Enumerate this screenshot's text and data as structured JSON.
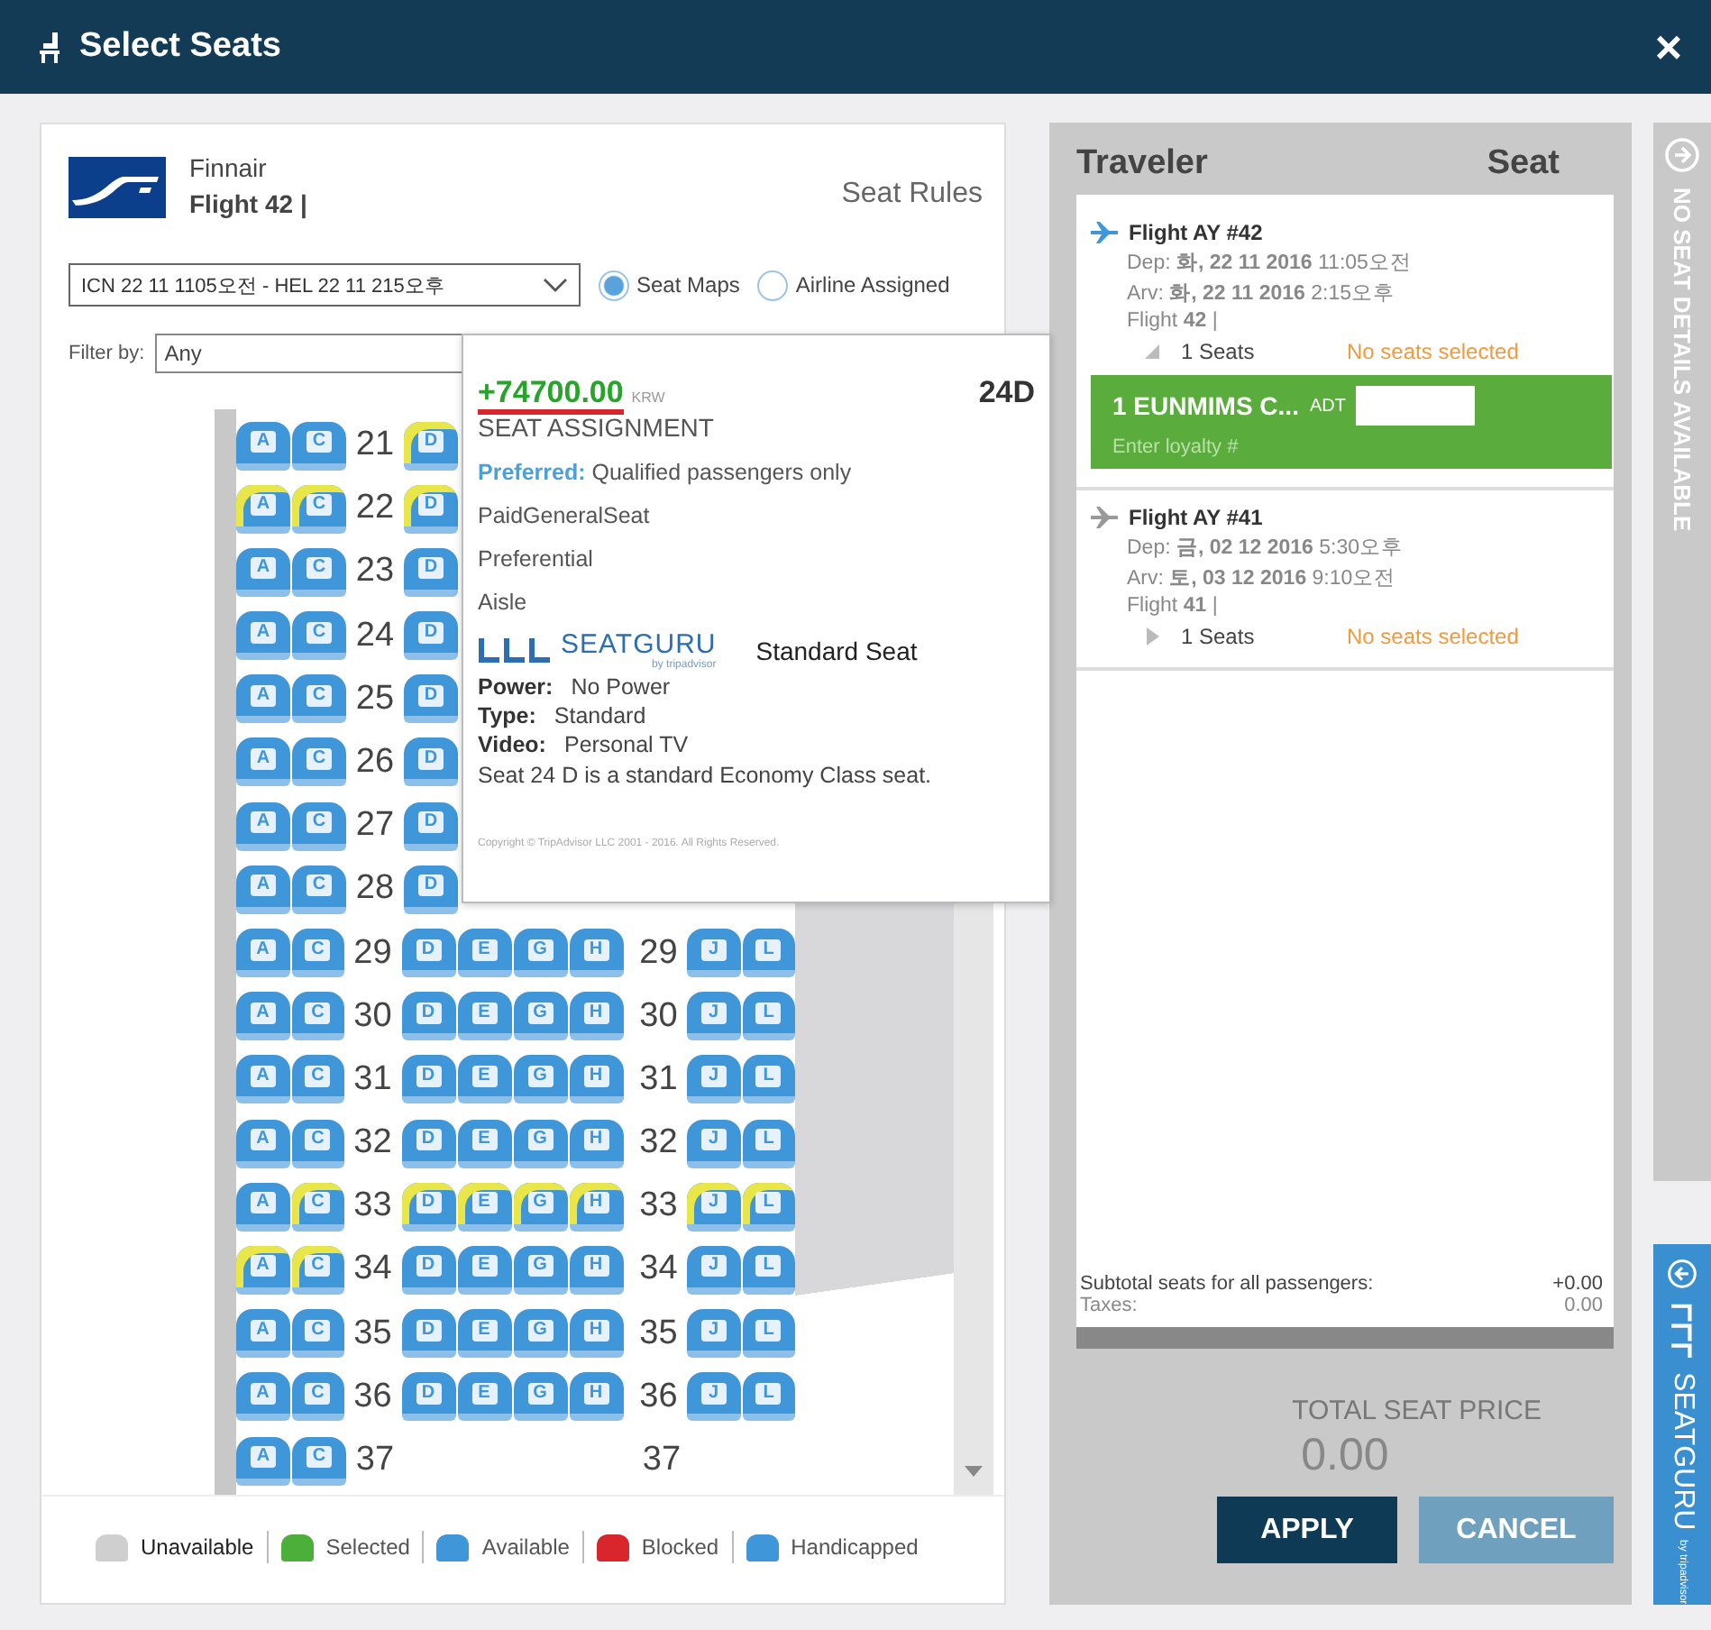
{
  "window": {
    "title": "Select Seats",
    "close": "×"
  },
  "flight_header": {
    "airline": "Finnair",
    "flight": "Flight 42 |",
    "seat_rules": "Seat Rules"
  },
  "segment_select": {
    "value": "ICN 22 11 1105오전 - HEL 22 11 215오후"
  },
  "map_mode": [
    {
      "label": "Seat Maps",
      "selected": true
    },
    {
      "label": "Airline Assigned",
      "selected": false
    }
  ],
  "filter": {
    "label": "Filter by:",
    "value": "Any"
  },
  "seat_rows": [
    {
      "number": "21",
      "left": [
        {
          "letter": "A",
          "highlighted": false
        },
        {
          "letter": "C",
          "highlighted": false
        }
      ],
      "middle": [
        {
          "letter": "D",
          "highlighted": true
        }
      ]
    },
    {
      "number": "22",
      "left": [
        {
          "letter": "A",
          "highlighted": true
        },
        {
          "letter": "C",
          "highlighted": true
        }
      ],
      "middle": [
        {
          "letter": "D",
          "highlighted": true
        }
      ]
    },
    {
      "number": "23",
      "left": [
        {
          "letter": "A",
          "highlighted": false
        },
        {
          "letter": "C",
          "highlighted": false
        }
      ],
      "middle": [
        {
          "letter": "D",
          "highlighted": false
        }
      ]
    },
    {
      "number": "24",
      "left": [
        {
          "letter": "A",
          "highlighted": false
        },
        {
          "letter": "C",
          "highlighted": false
        }
      ],
      "middle": [
        {
          "letter": "D",
          "highlighted": false
        }
      ]
    },
    {
      "number": "25",
      "left": [
        {
          "letter": "A",
          "highlighted": false
        },
        {
          "letter": "C",
          "highlighted": false
        }
      ],
      "middle": [
        {
          "letter": "D",
          "highlighted": false
        }
      ]
    },
    {
      "number": "26",
      "left": [
        {
          "letter": "A",
          "highlighted": false
        },
        {
          "letter": "C",
          "highlighted": false
        }
      ],
      "middle": [
        {
          "letter": "D",
          "highlighted": false
        }
      ]
    },
    {
      "number": "27",
      "left": [
        {
          "letter": "A",
          "highlighted": false
        },
        {
          "letter": "C",
          "highlighted": false
        }
      ],
      "middle": [
        {
          "letter": "D",
          "highlighted": false
        }
      ]
    },
    {
      "number": "28",
      "left": [
        {
          "letter": "A",
          "highlighted": false
        },
        {
          "letter": "C",
          "highlighted": false
        }
      ],
      "middle": [
        {
          "letter": "D",
          "highlighted": false
        }
      ]
    },
    {
      "number": "29",
      "left": [
        {
          "letter": "A",
          "highlighted": false
        },
        {
          "letter": "C",
          "highlighted": false
        }
      ],
      "middle": [
        {
          "letter": "D",
          "highlighted": false
        },
        {
          "letter": "E",
          "highlighted": false
        },
        {
          "letter": "G",
          "highlighted": false
        },
        {
          "letter": "H",
          "highlighted": false
        }
      ],
      "number_2": "29",
      "right": [
        {
          "letter": "J",
          "highlighted": false
        },
        {
          "letter": "L",
          "highlighted": false
        }
      ]
    },
    {
      "number": "30",
      "left": [
        {
          "letter": "A",
          "highlighted": false
        },
        {
          "letter": "C",
          "highlighted": false
        }
      ],
      "middle": [
        {
          "letter": "D",
          "highlighted": false
        },
        {
          "letter": "E",
          "highlighted": false
        },
        {
          "letter": "G",
          "highlighted": false
        },
        {
          "letter": "H",
          "highlighted": false
        }
      ],
      "number_2": "30",
      "right": [
        {
          "letter": "J",
          "highlighted": false
        },
        {
          "letter": "L",
          "highlighted": false
        }
      ]
    },
    {
      "number": "31",
      "left": [
        {
          "letter": "A",
          "highlighted": false
        },
        {
          "letter": "C",
          "highlighted": false
        }
      ],
      "middle": [
        {
          "letter": "D",
          "highlighted": false
        },
        {
          "letter": "E",
          "highlighted": false
        },
        {
          "letter": "G",
          "highlighted": false
        },
        {
          "letter": "H",
          "highlighted": false
        }
      ],
      "number_2": "31",
      "right": [
        {
          "letter": "J",
          "highlighted": false
        },
        {
          "letter": "L",
          "highlighted": false
        }
      ]
    },
    {
      "number": "32",
      "left": [
        {
          "letter": "A",
          "highlighted": false
        },
        {
          "letter": "C",
          "highlighted": false
        }
      ],
      "middle": [
        {
          "letter": "D",
          "highlighted": false
        },
        {
          "letter": "E",
          "highlighted": false
        },
        {
          "letter": "G",
          "highlighted": false
        },
        {
          "letter": "H",
          "highlighted": false
        }
      ],
      "number_2": "32",
      "right": [
        {
          "letter": "J",
          "highlighted": false
        },
        {
          "letter": "L",
          "highlighted": false
        }
      ]
    },
    {
      "number": "33",
      "left": [
        {
          "letter": "A",
          "highlighted": false
        },
        {
          "letter": "C",
          "highlighted": true
        }
      ],
      "middle": [
        {
          "letter": "D",
          "highlighted": true
        },
        {
          "letter": "E",
          "highlighted": true
        },
        {
          "letter": "G",
          "highlighted": true
        },
        {
          "letter": "H",
          "highlighted": true
        }
      ],
      "number_2": "33",
      "right": [
        {
          "letter": "J",
          "highlighted": true
        },
        {
          "letter": "L",
          "highlighted": true
        }
      ]
    },
    {
      "number": "34",
      "left": [
        {
          "letter": "A",
          "highlighted": true
        },
        {
          "letter": "C",
          "highlighted": true
        }
      ],
      "middle": [
        {
          "letter": "D",
          "highlighted": false
        },
        {
          "letter": "E",
          "highlighted": false
        },
        {
          "letter": "G",
          "highlighted": false
        },
        {
          "letter": "H",
          "highlighted": false
        }
      ],
      "number_2": "34",
      "right": [
        {
          "letter": "J",
          "highlighted": false
        },
        {
          "letter": "L",
          "highlighted": false
        }
      ]
    },
    {
      "number": "35",
      "left": [
        {
          "letter": "A",
          "highlighted": false
        },
        {
          "letter": "C",
          "highlighted": false
        }
      ],
      "middle": [
        {
          "letter": "D",
          "highlighted": false
        },
        {
          "letter": "E",
          "highlighted": false
        },
        {
          "letter": "G",
          "highlighted": false
        },
        {
          "letter": "H",
          "highlighted": false
        }
      ],
      "number_2": "35",
      "right": [
        {
          "letter": "J",
          "highlighted": false
        },
        {
          "letter": "L",
          "highlighted": false
        }
      ]
    },
    {
      "number": "36",
      "left": [
        {
          "letter": "A",
          "highlighted": false
        },
        {
          "letter": "C",
          "highlighted": false
        }
      ],
      "middle": [
        {
          "letter": "D",
          "highlighted": false
        },
        {
          "letter": "E",
          "highlighted": false
        },
        {
          "letter": "G",
          "highlighted": false
        },
        {
          "letter": "H",
          "highlighted": false
        }
      ],
      "number_2": "36",
      "right": [
        {
          "letter": "J",
          "highlighted": false
        },
        {
          "letter": "L",
          "highlighted": false
        }
      ]
    },
    {
      "number": "37",
      "left": [
        {
          "letter": "A",
          "highlighted": false
        },
        {
          "letter": "C",
          "highlighted": false
        }
      ],
      "number_2": "37"
    }
  ],
  "seat_popup": {
    "price": "+74700.00",
    "currency": "KRW",
    "seat": "24D",
    "heading": "SEAT ASSIGNMENT",
    "preferred_label": "Preferred:",
    "preferred_text": "Qualified passengers only",
    "attributes": [
      "PaidGeneralSeat",
      "Preferential",
      "Aisle"
    ],
    "brand": "SEATGURU",
    "byline": "by tripadvisor",
    "seat_type": "Standard Seat",
    "details": [
      {
        "label": "Power:",
        "value": "No Power"
      },
      {
        "label": "Type:",
        "value": "Standard"
      },
      {
        "label": "Video:",
        "value": "Personal TV"
      }
    ],
    "description": "Seat 24 D is a standard Economy Class seat.",
    "copyright": "Copyright © TripAdvisor LLC 2001 - 2016. All Rights Reserved."
  },
  "legend": [
    {
      "label": "Unavailable",
      "kind": "unavailable"
    },
    {
      "label": "Selected",
      "kind": "selected"
    },
    {
      "label": "Available",
      "kind": "available"
    },
    {
      "label": "Blocked",
      "kind": "blocked"
    },
    {
      "label": "Handicapped",
      "kind": "handicapped"
    }
  ],
  "traveler_panel": {
    "heading": "Traveler",
    "seat_heading": "Seat",
    "flights": [
      {
        "title": "Flight AY #42",
        "selected": true,
        "expanded": true,
        "departure": "Dep: **화, 22 11 2016** 11:05오전",
        "arrival": "Arv: **화, 22 11 2016** 2:15오후",
        "flight": "Flight **42** |",
        "seats": "1 Seats",
        "status": "No seats selected",
        "passengers": [
          {
            "name": "1 EUNMIMS C...",
            "type": "ADT",
            "loyalty_placeholder": "Enter loyalty #"
          }
        ]
      },
      {
        "title": "Flight AY #41",
        "selected": false,
        "expanded": false,
        "departure": "Dep: **금, 02 12 2016** 5:30오후",
        "arrival": "Arv: **토, 03 12 2016** 9:10오전",
        "flight": "Flight **41** |",
        "seats": "1 Seats",
        "status": "No seats selected"
      }
    ],
    "subtotal_label": "Subtotal seats for all passengers:",
    "subtotal": "+0.00",
    "taxes_label": "Taxes:",
    "taxes": "0.00"
  },
  "total": {
    "label": "TOTAL SEAT PRICE",
    "value": "0.00"
  },
  "buttons": [
    {
      "label": "APPLY",
      "kind": "primary"
    },
    {
      "label": "CANCEL",
      "kind": "secondary"
    }
  ],
  "side_strip": {
    "seat_details": "NO SEAT DETAILS AVAILABLE",
    "brand": "SEATGURU",
    "byline": "by tripadvisor"
  }
}
